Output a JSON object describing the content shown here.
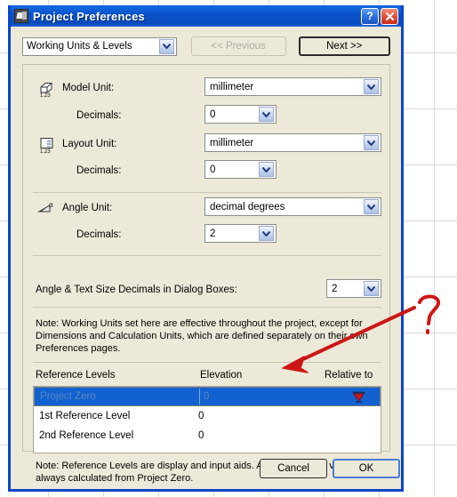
{
  "window": {
    "title": "Project Preferences",
    "icon": "app-window-icon",
    "help_button": "?",
    "close_button": "✕"
  },
  "nav": {
    "page_selected": "Working Units & Levels",
    "previous_label": "<< Previous",
    "next_label": "Next >>"
  },
  "settings": {
    "model_unit": {
      "label": "Model Unit:",
      "value": "millimeter",
      "icon": "model-unit-icon"
    },
    "model_decimals": {
      "label": "Decimals:",
      "value": "0"
    },
    "layout_unit": {
      "label": "Layout Unit:",
      "value": "millimeter",
      "icon": "layout-unit-icon"
    },
    "layout_decimals": {
      "label": "Decimals:",
      "value": "0"
    },
    "angle_unit": {
      "label": "Angle Unit:",
      "value": "decimal degrees",
      "icon": "angle-unit-icon"
    },
    "angle_decimals": {
      "label": "Decimals:",
      "value": "2"
    },
    "dialog_decimals": {
      "label": "Angle & Text Size Decimals in Dialog Boxes:",
      "value": "2"
    },
    "note": "Note: Working Units set here are effective throughout the project, except for Dimensions and Calculation Units, which are defined separately on their own Preferences pages."
  },
  "reference_levels": {
    "headers": {
      "name": "Reference Levels",
      "elevation": "Elevation",
      "relative_to": "Relative to"
    },
    "rows": [
      {
        "name": "Project Zero",
        "elevation": "0",
        "relative_to_icon": "datum-triangle-icon",
        "selected": true
      },
      {
        "name": "1st Reference Level",
        "elevation": "0",
        "relative_to_icon": "",
        "selected": false
      },
      {
        "name": "2nd Reference Level",
        "elevation": "0",
        "relative_to_icon": "",
        "selected": false
      }
    ],
    "note": "Note: Reference Levels are display and input aids. Actual Elevation values are always calculated from Project Zero."
  },
  "footer": {
    "cancel_label": "Cancel",
    "ok_label": "OK"
  },
  "annotation": {
    "question_mark": "?",
    "color": "#cc1616"
  },
  "colors": {
    "titlebar_blue": "#0a52c8",
    "dialog_face": "#ece9d8",
    "selection_blue": "#1162d0",
    "annotation_red": "#cc1616"
  }
}
